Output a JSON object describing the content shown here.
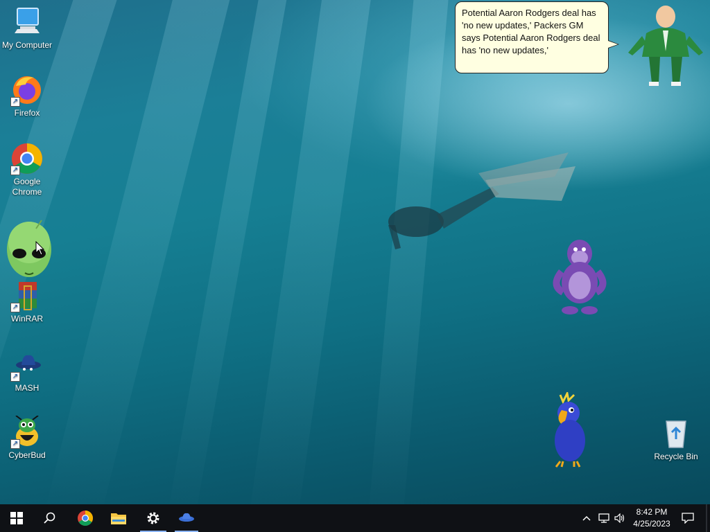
{
  "desktop": {
    "icons": [
      {
        "label": "My Computer",
        "icon": "monitor-icon"
      },
      {
        "label": "Firefox",
        "icon": "firefox-icon"
      },
      {
        "label": "Google Chrome",
        "icon": "chrome-icon"
      },
      {
        "label": "WinRAR",
        "icon": "winrar-icon"
      },
      {
        "label": "MASH",
        "icon": "mash-icon"
      },
      {
        "label": "CyberBud",
        "icon": "cyberbud-icon"
      },
      {
        "label": "Recycle Bin",
        "icon": "recycle-bin-icon"
      }
    ],
    "chrome_label_line1": "Google",
    "chrome_label_line2": "Chrome"
  },
  "speech_bubble": {
    "text": "Potential Aaron Rodgers deal has 'no new updates,' Packers GM says Potential Aaron Rodgers deal has 'no new updates,'"
  },
  "characters": [
    "green-suit-man",
    "alien-head",
    "purple-gorilla",
    "blue-parrot"
  ],
  "taskbar": {
    "buttons": [
      "start-icon",
      "search-icon",
      "chrome-icon",
      "file-explorer-icon",
      "settings-icon",
      "mash-icon"
    ],
    "active": [
      "settings",
      "mash"
    ],
    "clock": {
      "time": "8:42 PM",
      "date": "4/25/2023"
    },
    "tray": [
      "chevron-up-icon",
      "network-icon",
      "volume-icon",
      "notification-icon"
    ]
  },
  "colors": {
    "taskbar": "#0f1115",
    "bubble": "#ffffe1",
    "accent": "#8ab4f8"
  }
}
